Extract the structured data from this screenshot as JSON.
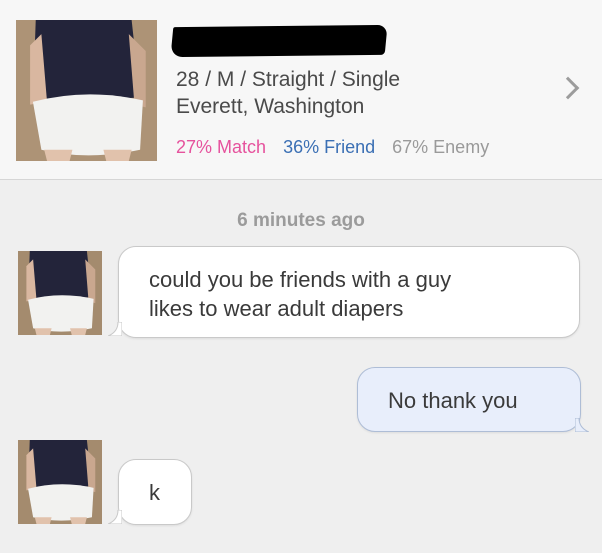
{
  "profile": {
    "redacted_name": "",
    "details_line1": "28 / M / Straight / Single",
    "details_line2": "Everett, Washington",
    "match": "27% Match",
    "friend": "36% Friend",
    "enemy": "67% Enemy",
    "icon": "chevron-right-icon"
  },
  "conversation": {
    "timestamp": "6 minutes ago",
    "messages": [
      {
        "from": "them",
        "text_line1": "could you be friends with a guy",
        "text_line2": "likes to wear adult diapers"
      },
      {
        "from": "me",
        "text": "No thank you"
      },
      {
        "from": "them",
        "text": "k"
      }
    ]
  },
  "colors": {
    "match": "#e6529d",
    "friend": "#3a6fb4",
    "enemy": "#9a9a9a",
    "outgoing_bubble": "#e8eefb"
  }
}
